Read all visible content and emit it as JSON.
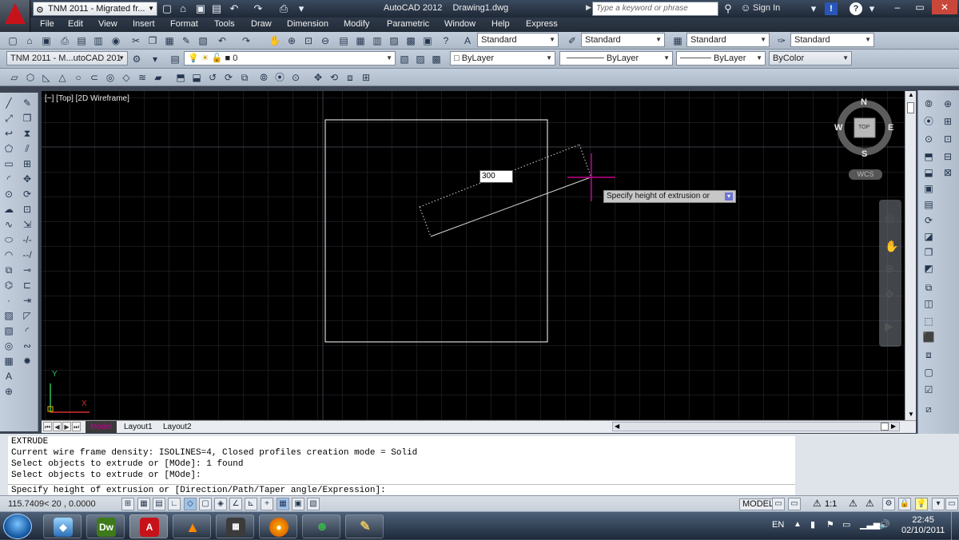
{
  "titlebar": {
    "workspace": "TNM 2011 - Migrated fr...",
    "app_name": "AutoCAD 2012",
    "document": "Drawing1.dwg",
    "search_placeholder": "Type a keyword or phrase",
    "sign_in": "Sign In"
  },
  "menu": [
    "File",
    "Edit",
    "View",
    "Insert",
    "Format",
    "Tools",
    "Draw",
    "Dimension",
    "Modify",
    "Parametric",
    "Window",
    "Help",
    "Express"
  ],
  "toolbar1": {
    "text_style": "Standard",
    "dim_style": "Standard",
    "table_style": "Standard",
    "mleader_style": "Standard"
  },
  "toolbar2": {
    "workspace": "TNM 2011 - M...utoCAD 201",
    "layer": "0",
    "color": "ByLayer",
    "linetype": "ByLayer",
    "lineweight": "ByLayer",
    "plotstyle": "ByColor"
  },
  "canvas": {
    "view_label": "[−] [Top] [2D Wireframe]",
    "dynamic_input": "300",
    "tooltip": "Specify height of extrusion or",
    "viewcube": {
      "n": "N",
      "s": "S",
      "e": "E",
      "w": "W",
      "top": "TOP",
      "wcs": "WCS"
    },
    "ucs": {
      "x": "X",
      "y": "Y"
    }
  },
  "tabs": {
    "model": "Model",
    "layout1": "Layout1",
    "layout2": "Layout2"
  },
  "command": {
    "lines": [
      "EXTRUDE",
      "Current wire frame density:  ISOLINES=4, Closed profiles creation mode = Solid",
      "Select objects to extrude or [MOde]: 1 found",
      "Select objects to extrude or [MOde]:"
    ],
    "prompt": "Specify height of extrusion or [Direction/Path/Taper angle/Expression]:"
  },
  "status": {
    "coords": "115.7409< 20   , 0.0000",
    "model": "MODEL",
    "scale": "1:1"
  },
  "taskbar": {
    "dw_label": "Dw",
    "lang": "EN",
    "time": "22:45",
    "date": "02/10/2011"
  },
  "colors": {
    "canvas_bg": "#000000",
    "crosshair": "#c3008c",
    "model_tab": "#c3008c",
    "tooltip_bg": "#c7c7c7"
  }
}
